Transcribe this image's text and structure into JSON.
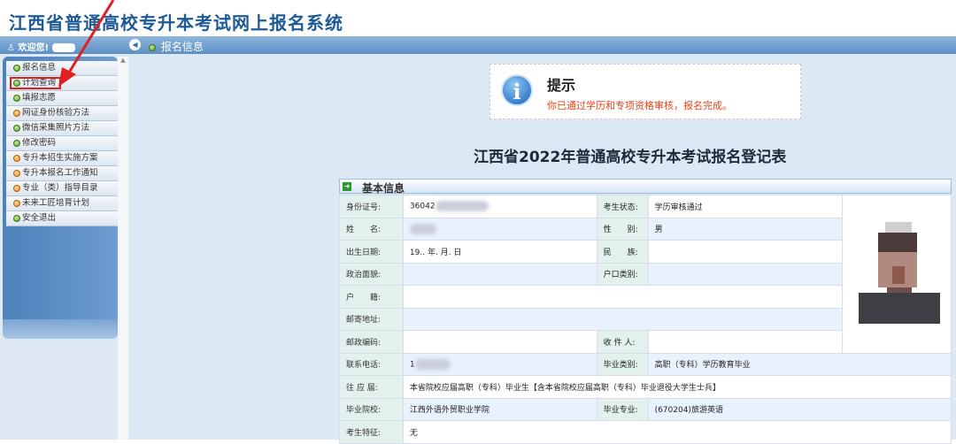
{
  "app_title": "江西省普通高校专升本考试网上报名系统",
  "topbar": {
    "welcome": "欢迎您!",
    "breadcrumb": "报名信息"
  },
  "sidebar": {
    "items": [
      {
        "label": "报名信息",
        "dot": "green"
      },
      {
        "label": "计划查询",
        "dot": "green",
        "highlighted": true
      },
      {
        "label": "填报志愿",
        "dot": "green"
      },
      {
        "label": "网证身份核验方法",
        "dot": "orange"
      },
      {
        "label": "微信采集照片方法",
        "dot": "green"
      },
      {
        "label": "修改密码",
        "dot": "green"
      },
      {
        "label": "专升本招生实施方案",
        "dot": "orange"
      },
      {
        "label": "专升本报名工作通知",
        "dot": "orange"
      },
      {
        "label": "专业（类）指导目录",
        "dot": "orange"
      },
      {
        "label": "未来工匠培育计划",
        "dot": "orange"
      },
      {
        "label": "安全退出",
        "dot": "green"
      }
    ]
  },
  "notice": {
    "title": "提示",
    "message": "你已通过学历和专项资格审核，报名完成。",
    "icon": "info-icon"
  },
  "form_title": "江西省2022年普通高校专升本考试报名登记表",
  "section_title": "基本信息",
  "fields": {
    "id_label": "身份证号:",
    "id_value": "36042",
    "status_label": "考生状态:",
    "status_value": "学历审核通过",
    "name_label": "姓　　名:",
    "gender_label": "性　　别:",
    "gender_value": "男",
    "birth_label": "出生日期:",
    "birth_value": "19.. 年. 月. 日",
    "ethnic_label": "民　　族:",
    "political_label": "政治面貌:",
    "hukou_type_label": "户口类别:",
    "hukou_label": "户　　籍:",
    "address_label": "邮寄地址:",
    "postcode_label": "邮政编码:",
    "recipient_label": "收 件 人:",
    "phone_label": "联系电话:",
    "phone_value": "1",
    "grad_type_label": "毕业类别:",
    "grad_type_value": "高职（专科）学历教育毕业",
    "fresh_label": "往 应 届:",
    "fresh_value": "本省院校应届高职（专科）毕业生【含本省院校应届高职（专科）毕业退役大学生士兵】",
    "school_label": "毕业院校:",
    "school_value": "江西外语外贸职业学院",
    "major_label": "毕业专业:",
    "major_value": "(670204)旅游英语",
    "feature_label": "考生特征:",
    "feature_value": "无"
  },
  "colors": {
    "title": "#1d5a96",
    "notice": "#e8441a",
    "annotation": "#e02020"
  }
}
